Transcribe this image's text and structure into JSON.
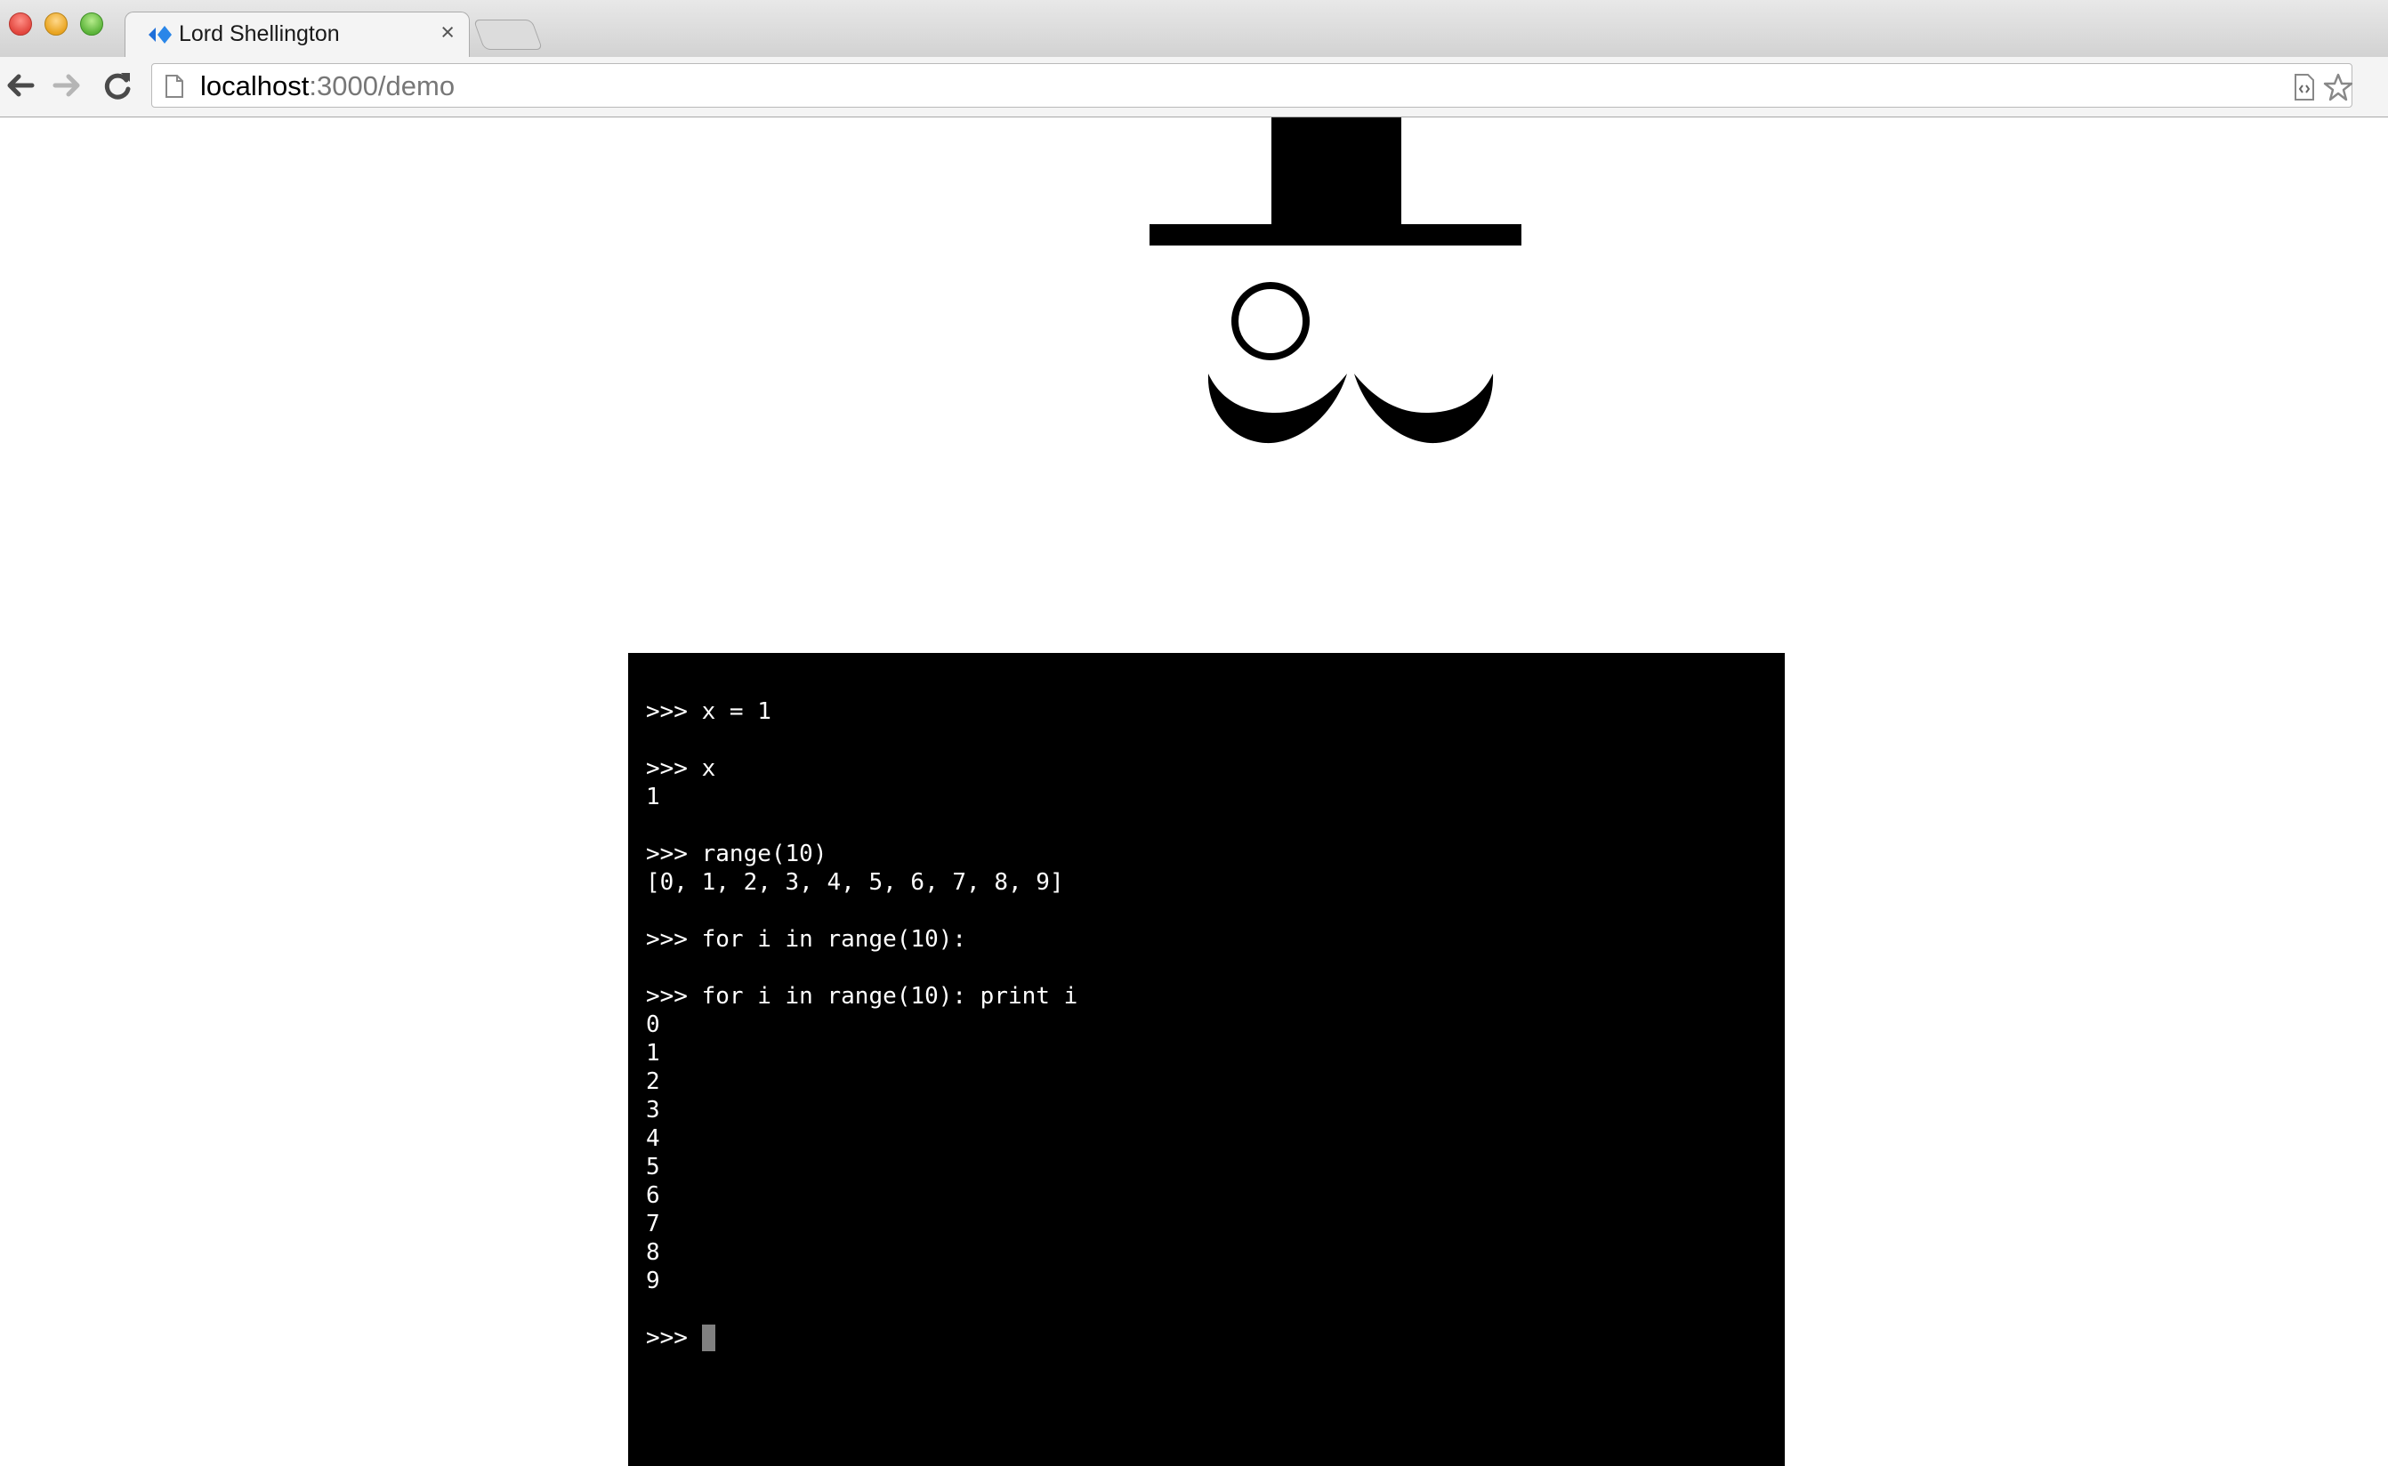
{
  "browser": {
    "tab": {
      "title": "Lord Shellington",
      "close_glyph": "×"
    },
    "address_bar": {
      "host": "localhost",
      "rest": ":3000/demo"
    },
    "icons": [
      "back-icon",
      "forward-icon",
      "reload-icon",
      "page-icon",
      "page-source-icon",
      "bookmark-star-icon"
    ]
  },
  "terminal": {
    "lines": [
      ">>> x = 1",
      "",
      ">>> x",
      "1",
      "",
      ">>> range(10)",
      "[0, 1, 2, 3, 4, 5, 6, 7, 8, 9]",
      "",
      ">>> for i in range(10):",
      "",
      ">>> for i in range(10): print i",
      "0",
      "1",
      "2",
      "3",
      "4",
      "5",
      "6",
      "7",
      "8",
      "9",
      ""
    ],
    "prompt": ">>> ",
    "input_value": "",
    "background": "#000000",
    "foreground": "#ffffff"
  }
}
